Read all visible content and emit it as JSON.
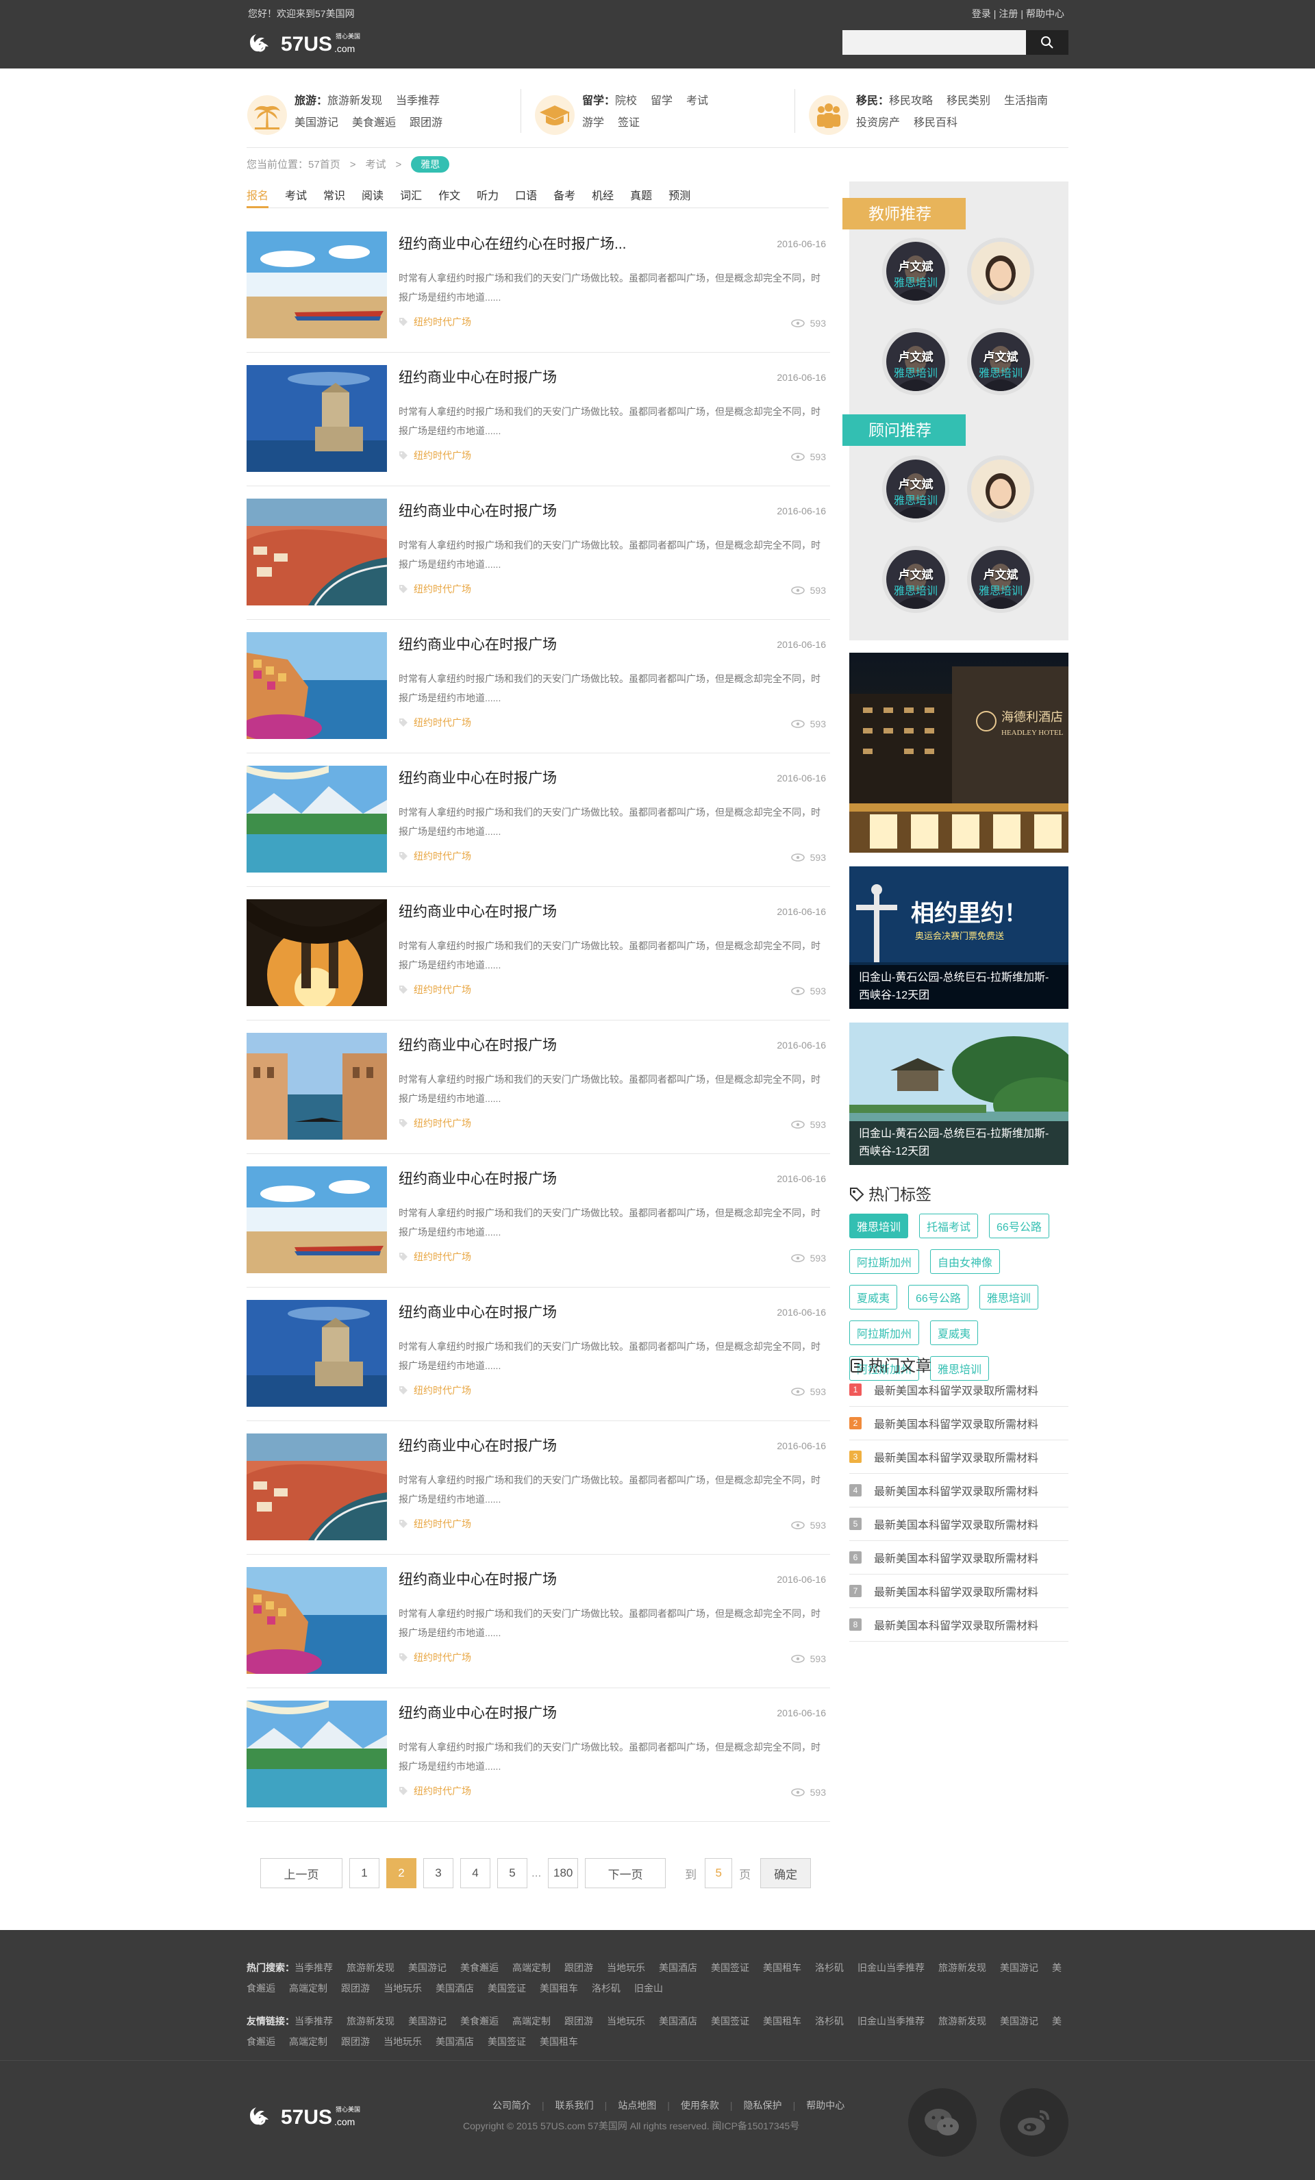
{
  "header": {
    "greeting": "您好！欢迎来到57美国网",
    "login": "登录",
    "register": "注册",
    "help": "帮助中心",
    "search_placeholder": ""
  },
  "nav": {
    "travel": {
      "title": "旅游：",
      "links": [
        "旅游新发现",
        "当季推荐",
        "美国游记",
        "美食邂逅",
        "跟团游"
      ]
    },
    "study": {
      "title": "留学：",
      "links": [
        "院校",
        "留学",
        "考试",
        "游学",
        "签证"
      ]
    },
    "immig": {
      "title": "移民：",
      "links": [
        "移民攻略",
        "移民类别",
        "生活指南",
        "投资房产",
        "移民百科"
      ]
    }
  },
  "breadcrumb": {
    "prefix": "您当前位置：",
    "home": "57首页",
    "sep": ">",
    "exam": "考试",
    "current": "雅思"
  },
  "tabs": [
    "报名",
    "考试",
    "常识",
    "阅读",
    "词汇",
    "作文",
    "听力",
    "口语",
    "备考",
    "机经",
    "真题",
    "预测"
  ],
  "articles": [
    {
      "title": "纽约商业中心在纽约心在时报广场...",
      "date": "2016-06-16",
      "desc": "时常有人拿纽约时报广场和我们的天安门广场做比较。虽都同者都叫广场，但是概念却完全不同，时报广场是纽约市地道......",
      "tag": "纽约时代广场",
      "views": "593",
      "img": "beach"
    },
    {
      "title": "纽约商业中心在时报广场",
      "date": "2016-06-16",
      "desc": "时常有人拿纽约时报广场和我们的天安门广场做比较。虽都同者都叫广场，但是概念却完全不同，时报广场是纽约市地道......",
      "tag": "纽约时代广场",
      "views": "593",
      "img": "tower"
    },
    {
      "title": "纽约商业中心在时报广场",
      "date": "2016-06-16",
      "desc": "时常有人拿纽约时报广场和我们的天安门广场做比较。虽都同者都叫广场，但是概念却完全不同，时报广场是纽约市地道......",
      "tag": "纽约时代广场",
      "views": "593",
      "img": "town"
    },
    {
      "title": "纽约商业中心在时报广场",
      "date": "2016-06-16",
      "desc": "时常有人拿纽约时报广场和我们的天安门广场做比较。虽都同者都叫广场，但是概念却完全不同，时报广场是纽约市地道......",
      "tag": "纽约时代广场",
      "views": "593",
      "img": "cliff"
    },
    {
      "title": "纽约商业中心在时报广场",
      "date": "2016-06-16",
      "desc": "时常有人拿纽约时报广场和我们的天安门广场做比较。虽都同者都叫广场，但是概念却完全不同，时报广场是纽约市地道......",
      "tag": "纽约时代广场",
      "views": "593",
      "img": "lake"
    },
    {
      "title": "纽约商业中心在时报广场",
      "date": "2016-06-16",
      "desc": "时常有人拿纽约时报广场和我们的天安门广场做比较。虽都同者都叫广场，但是概念却完全不同，时报广场是纽约市地道......",
      "tag": "纽约时代广场",
      "views": "593",
      "img": "bridge"
    },
    {
      "title": "纽约商业中心在时报广场",
      "date": "2016-06-16",
      "desc": "时常有人拿纽约时报广场和我们的天安门广场做比较。虽都同者都叫广场，但是概念却完全不同，时报广场是纽约市地道......",
      "tag": "纽约时代广场",
      "views": "593",
      "img": "venice"
    },
    {
      "title": "纽约商业中心在时报广场",
      "date": "2016-06-16",
      "desc": "时常有人拿纽约时报广场和我们的天安门广场做比较。虽都同者都叫广场，但是概念却完全不同，时报广场是纽约市地道......",
      "tag": "纽约时代广场",
      "views": "593",
      "img": "beach"
    },
    {
      "title": "纽约商业中心在时报广场",
      "date": "2016-06-16",
      "desc": "时常有人拿纽约时报广场和我们的天安门广场做比较。虽都同者都叫广场，但是概念却完全不同，时报广场是纽约市地道......",
      "tag": "纽约时代广场",
      "views": "593",
      "img": "tower"
    },
    {
      "title": "纽约商业中心在时报广场",
      "date": "2016-06-16",
      "desc": "时常有人拿纽约时报广场和我们的天安门广场做比较。虽都同者都叫广场，但是概念却完全不同，时报广场是纽约市地道......",
      "tag": "纽约时代广场",
      "views": "593",
      "img": "town"
    },
    {
      "title": "纽约商业中心在时报广场",
      "date": "2016-06-16",
      "desc": "时常有人拿纽约时报广场和我们的天安门广场做比较。虽都同者都叫广场，但是概念却完全不同，时报广场是纽约市地道......",
      "tag": "纽约时代广场",
      "views": "593",
      "img": "cliff"
    },
    {
      "title": "纽约商业中心在时报广场",
      "date": "2016-06-16",
      "desc": "时常有人拿纽约时报广场和我们的天安门广场做比较。虽都同者都叫广场，但是概念却完全不同，时报广场是纽约市地道......",
      "tag": "纽约时代广场",
      "views": "593",
      "img": "lake"
    }
  ],
  "pager": {
    "prev": "上一页",
    "pages": [
      "1",
      "2",
      "3",
      "4",
      "5"
    ],
    "ellipsis": "...",
    "last": "180",
    "next": "下一页",
    "goto": "到",
    "goto_value": "5",
    "page_unit": "页",
    "confirm": "确定",
    "current": "2"
  },
  "sidebar": {
    "teacher_title": "教师推荐",
    "advisor_title": "顾问推荐",
    "teacher_avatars": [
      {
        "name": "卢文斌",
        "sub": "雅思培训",
        "kind": "man"
      },
      {
        "name": "",
        "sub": "",
        "kind": "woman"
      },
      {
        "name": "卢文斌",
        "sub": "雅思培训",
        "kind": "man"
      },
      {
        "name": "卢文斌",
        "sub": "雅思培训",
        "kind": "man"
      }
    ],
    "advisor_avatars": [
      {
        "name": "卢文斌",
        "sub": "雅思培训",
        "kind": "man"
      },
      {
        "name": "",
        "sub": "",
        "kind": "woman"
      },
      {
        "name": "卢文斌",
        "sub": "雅思培训",
        "kind": "man"
      },
      {
        "name": "卢文斌",
        "sub": "雅思培训",
        "kind": "man"
      }
    ],
    "hotel_sign": "海德利酒店",
    "hotel_sign_en": "HEADLEY HOTEL",
    "ad2_headline": "相约里约！",
    "ad2_sub": "奥运会决赛门票免费送",
    "ad2_caption": "旧金山-黄石公园-总统巨石-拉斯维加斯-西峡谷-12天团",
    "ad3_caption": "旧金山-黄石公园-总统巨石-拉斯维加斯-西峡谷-12天团",
    "hot_tags_title": "热门标签",
    "hot_tags": [
      "雅思培训",
      "托福考试",
      "66号公路",
      "阿拉斯加州",
      "自由女神像",
      "夏威夷",
      "66号公路",
      "雅思培训",
      "阿拉斯加州",
      "夏威夷",
      "阿拉斯加州",
      "雅思培训"
    ],
    "hot_articles_title": "热门文章",
    "hot_articles": [
      "最新美国本科留学双录取所需材料",
      "最新美国本科留学双录取所需材料",
      "最新美国本科留学双录取所需材料",
      "最新美国本科留学双录取所需材料",
      "最新美国本科留学双录取所需材料",
      "最新美国本科留学双录取所需材料",
      "最新美国本科留学双录取所需材料",
      "最新美国本科留学双录取所需材料"
    ],
    "hot_nums": [
      "1",
      "2",
      "3",
      "4",
      "5",
      "6",
      "7",
      "8"
    ]
  },
  "footer": {
    "hot_search_label": "热门搜索：",
    "hot_search": [
      "当季推荐",
      "旅游新发现",
      "美国游记",
      "美食邂逅",
      "高端定制",
      "跟团游",
      "当地玩乐",
      "美国酒店",
      "美国签证",
      "美国租车",
      "洛杉矶",
      "旧金山当季推荐",
      "旅游新发现",
      "美国游记",
      "美食邂逅",
      "高端定制",
      "跟团游",
      "当地玩乐",
      "美国酒店",
      "美国签证",
      "美国租车",
      "洛杉矶",
      "旧金山"
    ],
    "friend_label": "友情链接：",
    "friend_links": [
      "当季推荐",
      "旅游新发现",
      "美国游记",
      "美食邂逅",
      "高端定制",
      "跟团游",
      "当地玩乐",
      "美国酒店",
      "美国签证",
      "美国租车",
      "洛杉矶",
      "旧金山当季推荐",
      "旅游新发现",
      "美国游记",
      "美食邂逅",
      "高端定制",
      "跟团游",
      "当地玩乐",
      "美国酒店",
      "美国签证",
      "美国租车"
    ],
    "nav": [
      "公司简介",
      "联系我们",
      "站点地图",
      "使用条款",
      "隐私保护",
      "帮助中心"
    ],
    "copyright": "Copyright © 2015 57US.com 57美国网 All rights reserved. 闽ICP备15017345号"
  },
  "logo": {
    "text": "57US",
    "dotcom": ".com",
    "tagline": "猎心美国"
  }
}
